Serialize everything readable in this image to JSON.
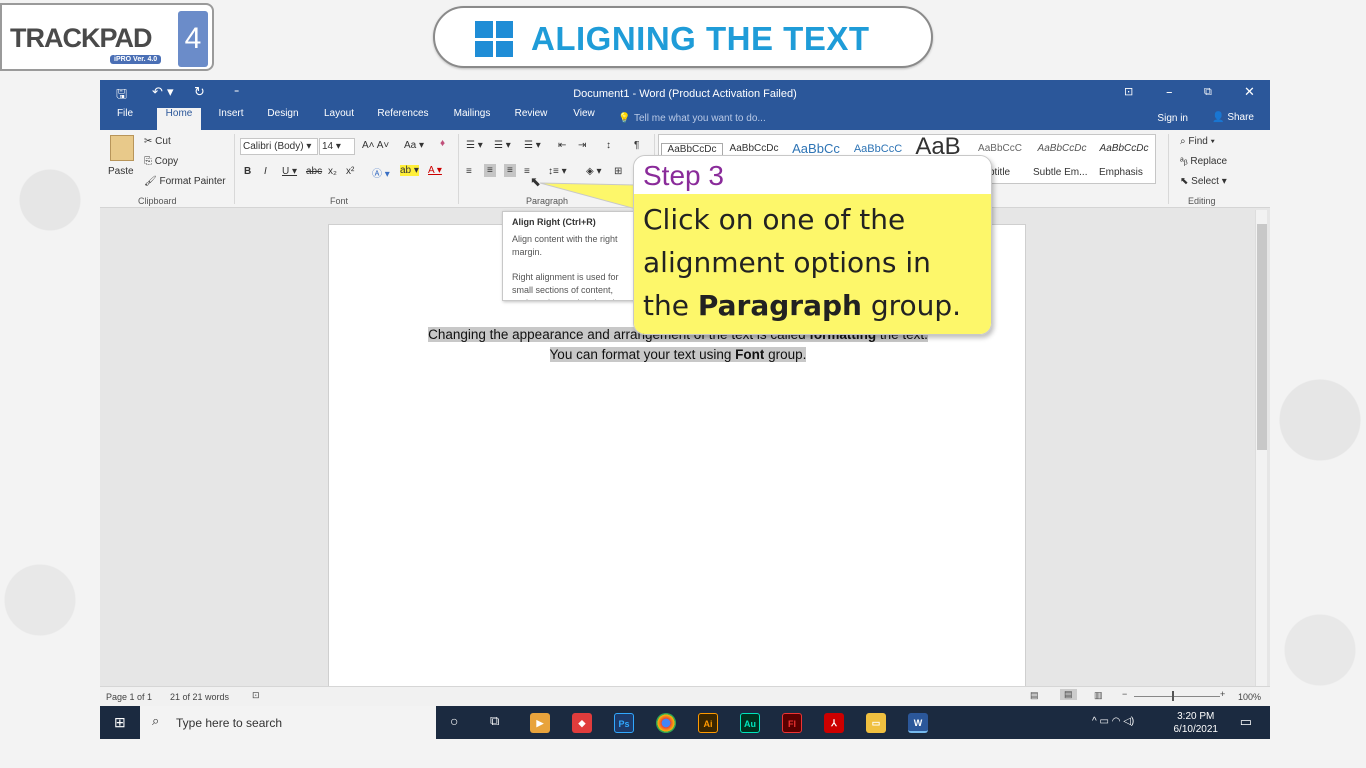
{
  "header": {
    "logo_text": "TRACKPAD",
    "logo_sub": "iPRO Ver. 4.0",
    "logo_num": "4",
    "title": "ALIGNING THE TEXT"
  },
  "word": {
    "window_title": "Document1 - Word (Product Activation Failed)",
    "tabs": [
      "File",
      "Home",
      "Insert",
      "Design",
      "Layout",
      "References",
      "Mailings",
      "Review",
      "View"
    ],
    "tell_me": "Tell me what you want to do...",
    "sign_in": "Sign in",
    "share": "Share",
    "clipboard": {
      "paste": "Paste",
      "cut": "Cut",
      "copy": "Copy",
      "format_painter": "Format Painter",
      "label": "Clipboard"
    },
    "font": {
      "name": "Calibri (Body)",
      "size": "14",
      "label": "Font"
    },
    "paragraph_label": "Paragraph",
    "styles": [
      "AaBbCcDc",
      "AaBbCcDc",
      "AaBbCc",
      "AaBbCcC",
      "AaB",
      "AaBbCcC",
      "AaBbCcDc",
      "AaBbCcDc"
    ],
    "style_names": [
      "btitle",
      "Subtle Em...",
      "Emphasis"
    ],
    "editing": {
      "find": "Find",
      "replace": "Replace",
      "select": "Select",
      "label": "Editing"
    },
    "document_text_part1": "Changing the appearance and arrangement of the text is called ",
    "document_text_bold1": "formatting",
    "document_text_part2": " the text. You can format your text using ",
    "document_text_bold2": "Font",
    "document_text_part3": " group.",
    "status": {
      "page": "Page 1 of 1",
      "words": "21 of 21 words",
      "zoom": "100%"
    }
  },
  "tooltip": {
    "title": "Align Right (Ctrl+R)",
    "line1": "Align content with the right margin.",
    "line2": "Right alignment is used for small sections of content, such as the text in a header or footer."
  },
  "callout": {
    "step": "Step 3",
    "text_before": "Click on one of the alignment options in the ",
    "text_bold": "Paragraph",
    "text_after": " group."
  },
  "taskbar": {
    "search_placeholder": "Type here to search",
    "time": "3:20 PM",
    "date": "6/10/2021"
  }
}
